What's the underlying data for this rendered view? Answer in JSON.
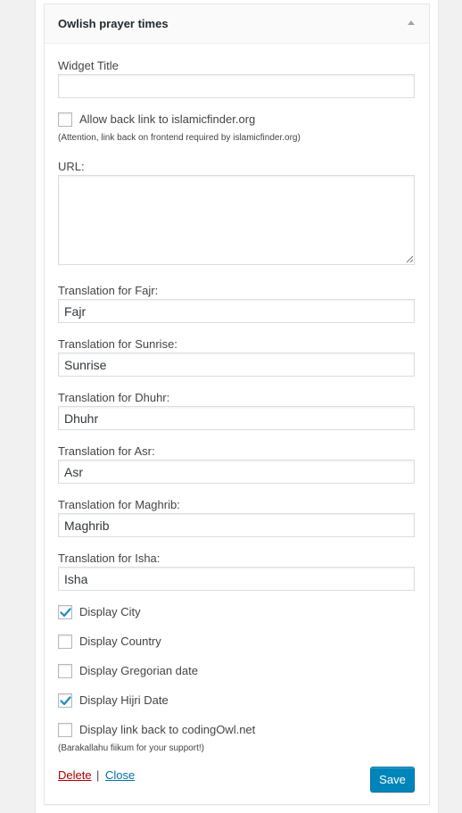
{
  "widget": {
    "title": "Owlish prayer times"
  },
  "form": {
    "widget_title": {
      "label": "Widget Title",
      "value": ""
    },
    "allow_backlink": {
      "label": "Allow back link to islamicfinder.org",
      "checked": false,
      "note": "(Attention, link back on frontend required by islamicfinder.org)"
    },
    "url": {
      "label": "URL:",
      "value": ""
    },
    "translations": [
      {
        "label": "Translation for Fajr:",
        "value": "Fajr"
      },
      {
        "label": "Translation for Sunrise:",
        "value": "Sunrise"
      },
      {
        "label": "Translation for Dhuhr:",
        "value": "Dhuhr"
      },
      {
        "label": "Translation for Asr:",
        "value": "Asr"
      },
      {
        "label": "Translation for Maghrib:",
        "value": "Maghrib"
      },
      {
        "label": "Translation for Isha:",
        "value": "Isha"
      }
    ],
    "options": [
      {
        "label": "Display City",
        "checked": true
      },
      {
        "label": "Display Country",
        "checked": false
      },
      {
        "label": "Display Gregorian date",
        "checked": false
      },
      {
        "label": "Display Hijri Date",
        "checked": true
      },
      {
        "label": "Display link back to codingOwl.net",
        "checked": false
      }
    ],
    "support_note": "(Barakallahu fiikum for your support!)"
  },
  "actions": {
    "delete_label": "Delete",
    "separator": "|",
    "close_label": "Close",
    "save_label": "Save"
  },
  "colors": {
    "accent": "#0085ba",
    "link": "#0073aa",
    "delete": "#aa0000",
    "check": "#1e8cbe"
  }
}
